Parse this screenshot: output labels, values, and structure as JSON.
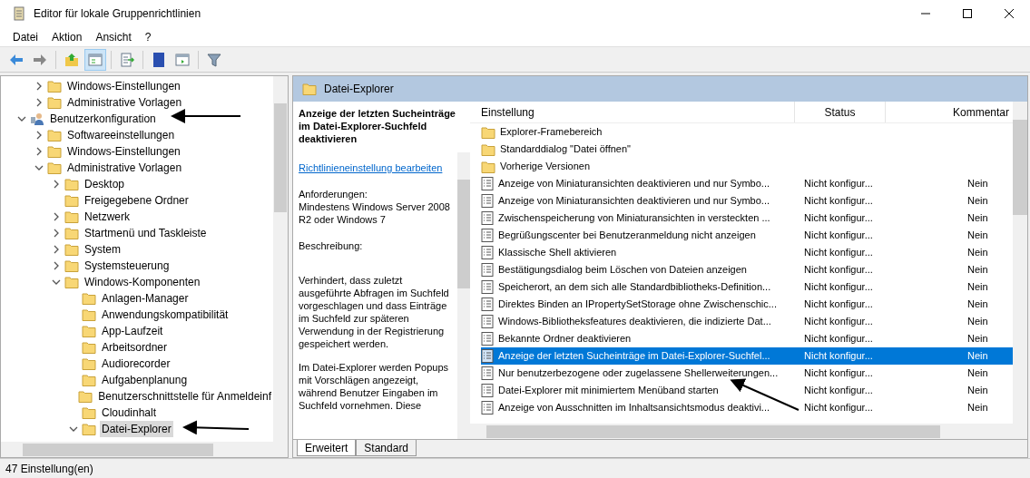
{
  "window": {
    "title": "Editor für lokale Gruppenrichtlinien"
  },
  "menu": [
    "Datei",
    "Aktion",
    "Ansicht",
    "?"
  ],
  "toolbar": [
    {
      "kind": "back",
      "pressed": false
    },
    {
      "kind": "forward",
      "pressed": false
    },
    {
      "kind": "sep"
    },
    {
      "kind": "up",
      "pressed": false
    },
    {
      "kind": "tree",
      "pressed": true
    },
    {
      "kind": "sep"
    },
    {
      "kind": "export",
      "pressed": false
    },
    {
      "kind": "sep"
    },
    {
      "kind": "help",
      "pressed": false
    },
    {
      "kind": "view",
      "pressed": false
    },
    {
      "kind": "sep"
    },
    {
      "kind": "filter",
      "pressed": false
    }
  ],
  "tree": {
    "continued": [
      {
        "label": "Windows-Einstellungen",
        "kind": "folder",
        "expandable": true,
        "expanded": false,
        "selected": false
      },
      {
        "label": "Administrative Vorlagen",
        "kind": "folder",
        "expandable": true,
        "expanded": false,
        "selected": false
      }
    ],
    "items": [
      {
        "label": "Benutzerkonfiguration",
        "kind": "user",
        "expandable": true,
        "expanded": true,
        "selected": false,
        "children": [
          {
            "label": "Softwareeinstellungen",
            "kind": "folder",
            "expandable": true,
            "expanded": false,
            "selected": false
          },
          {
            "label": "Windows-Einstellungen",
            "kind": "folder",
            "expandable": true,
            "expanded": false,
            "selected": false
          },
          {
            "label": "Administrative Vorlagen",
            "kind": "folder",
            "expandable": true,
            "expanded": true,
            "selected": false,
            "children": [
              {
                "label": "Desktop",
                "kind": "folder",
                "expandable": true,
                "expanded": false,
                "selected": false
              },
              {
                "label": "Freigegebene Ordner",
                "kind": "folder",
                "expandable": false,
                "selected": false
              },
              {
                "label": "Netzwerk",
                "kind": "folder",
                "expandable": true,
                "expanded": false,
                "selected": false
              },
              {
                "label": "Startmenü und Taskleiste",
                "kind": "folder",
                "expandable": true,
                "expanded": false,
                "selected": false
              },
              {
                "label": "System",
                "kind": "folder",
                "expandable": true,
                "expanded": false,
                "selected": false
              },
              {
                "label": "Systemsteuerung",
                "kind": "folder",
                "expandable": true,
                "expanded": false,
                "selected": false
              },
              {
                "label": "Windows-Komponenten",
                "kind": "folder",
                "expandable": true,
                "expanded": true,
                "selected": false,
                "children": [
                  {
                    "label": "Anlagen-Manager",
                    "kind": "folder",
                    "expandable": false,
                    "selected": false
                  },
                  {
                    "label": "Anwendungskompatibilität",
                    "kind": "folder",
                    "expandable": false,
                    "selected": false
                  },
                  {
                    "label": "App-Laufzeit",
                    "kind": "folder",
                    "expandable": false,
                    "selected": false
                  },
                  {
                    "label": "Arbeitsordner",
                    "kind": "folder",
                    "expandable": false,
                    "selected": false
                  },
                  {
                    "label": "Audiorecorder",
                    "kind": "folder",
                    "expandable": false,
                    "selected": false
                  },
                  {
                    "label": "Aufgabenplanung",
                    "kind": "folder",
                    "expandable": false,
                    "selected": false
                  },
                  {
                    "label": "Benutzerschnittstelle für Anmeldeinf",
                    "kind": "folder",
                    "expandable": false,
                    "selected": false
                  },
                  {
                    "label": "Cloudinhalt",
                    "kind": "folder",
                    "expandable": false,
                    "selected": false
                  },
                  {
                    "label": "Datei-Explorer",
                    "kind": "folder",
                    "expandable": true,
                    "expanded": true,
                    "selected": true
                  }
                ]
              }
            ]
          }
        ]
      }
    ]
  },
  "detail": {
    "header": "Datei-Explorer",
    "title": "Anzeige der letzten Sucheinträge im Datei-Explorer-Suchfeld deaktivieren",
    "link": "Richtlinieneinstellung bearbeiten",
    "requirements_label": "Anforderungen:",
    "requirements": "Mindestens Windows Server 2008 R2 oder Windows 7",
    "description_label": "Beschreibung:",
    "paragraphs": [
      "Verhindert, dass zuletzt ausgeführte Abfragen im Suchfeld vorgeschlagen und dass Einträge im Suchfeld zur späteren Verwendung in der Registrierung gespeichert werden.",
      "Im Datei-Explorer werden Popups mit Vorschlägen angezeigt, während Benutzer Eingaben im Suchfeld vornehmen.  Diese"
    ]
  },
  "table": {
    "columns": [
      "Einstellung",
      "Status",
      "Kommentar"
    ],
    "rows": [
      {
        "kind": "folder",
        "name": "Explorer-Framebereich",
        "status": "",
        "comment": "",
        "selected": false
      },
      {
        "kind": "folder",
        "name": "Standarddialog \"Datei öffnen\"",
        "status": "",
        "comment": "",
        "selected": false
      },
      {
        "kind": "folder",
        "name": "Vorherige Versionen",
        "status": "",
        "comment": "",
        "selected": false
      },
      {
        "kind": "setting",
        "name": "Anzeige von Miniaturansichten deaktivieren und nur Symbo...",
        "status": "Nicht konfigur...",
        "comment": "Nein",
        "selected": false
      },
      {
        "kind": "setting",
        "name": "Anzeige von Miniaturansichten deaktivieren und nur Symbo...",
        "status": "Nicht konfigur...",
        "comment": "Nein",
        "selected": false
      },
      {
        "kind": "setting",
        "name": "Zwischenspeicherung von Miniaturansichten in versteckten ...",
        "status": "Nicht konfigur...",
        "comment": "Nein",
        "selected": false
      },
      {
        "kind": "setting",
        "name": "Begrüßungscenter bei Benutzeranmeldung nicht anzeigen",
        "status": "Nicht konfigur...",
        "comment": "Nein",
        "selected": false
      },
      {
        "kind": "setting",
        "name": "Klassische Shell aktivieren",
        "status": "Nicht konfigur...",
        "comment": "Nein",
        "selected": false
      },
      {
        "kind": "setting",
        "name": "Bestätigungsdialog beim Löschen von Dateien anzeigen",
        "status": "Nicht konfigur...",
        "comment": "Nein",
        "selected": false
      },
      {
        "kind": "setting",
        "name": "Speicherort, an dem sich alle Standardbibliotheks-Definition...",
        "status": "Nicht konfigur...",
        "comment": "Nein",
        "selected": false
      },
      {
        "kind": "setting",
        "name": "Direktes Binden an IPropertySetStorage ohne Zwischenschic...",
        "status": "Nicht konfigur...",
        "comment": "Nein",
        "selected": false
      },
      {
        "kind": "setting",
        "name": "Windows-Bibliotheksfeatures deaktivieren, die indizierte Dat...",
        "status": "Nicht konfigur...",
        "comment": "Nein",
        "selected": false
      },
      {
        "kind": "setting",
        "name": "Bekannte Ordner deaktivieren",
        "status": "Nicht konfigur...",
        "comment": "Nein",
        "selected": false
      },
      {
        "kind": "setting",
        "name": "Anzeige der letzten Sucheinträge im Datei-Explorer-Suchfel...",
        "status": "Nicht konfigur...",
        "comment": "Nein",
        "selected": true
      },
      {
        "kind": "setting",
        "name": "Nur benutzerbezogene oder zugelassene Shellerweiterungen...",
        "status": "Nicht konfigur...",
        "comment": "Nein",
        "selected": false
      },
      {
        "kind": "setting",
        "name": "Datei-Explorer mit minimiertem Menüband starten",
        "status": "Nicht konfigur...",
        "comment": "Nein",
        "selected": false
      },
      {
        "kind": "setting",
        "name": "Anzeige von Ausschnitten im Inhaltsansichtsmodus deaktivi...",
        "status": "Nicht konfigur...",
        "comment": "Nein",
        "selected": false
      }
    ]
  },
  "view_tabs": [
    {
      "label": "Erweitert",
      "selected": true
    },
    {
      "label": "Standard",
      "selected": false
    }
  ],
  "status_bar": "47 Einstellung(en)"
}
